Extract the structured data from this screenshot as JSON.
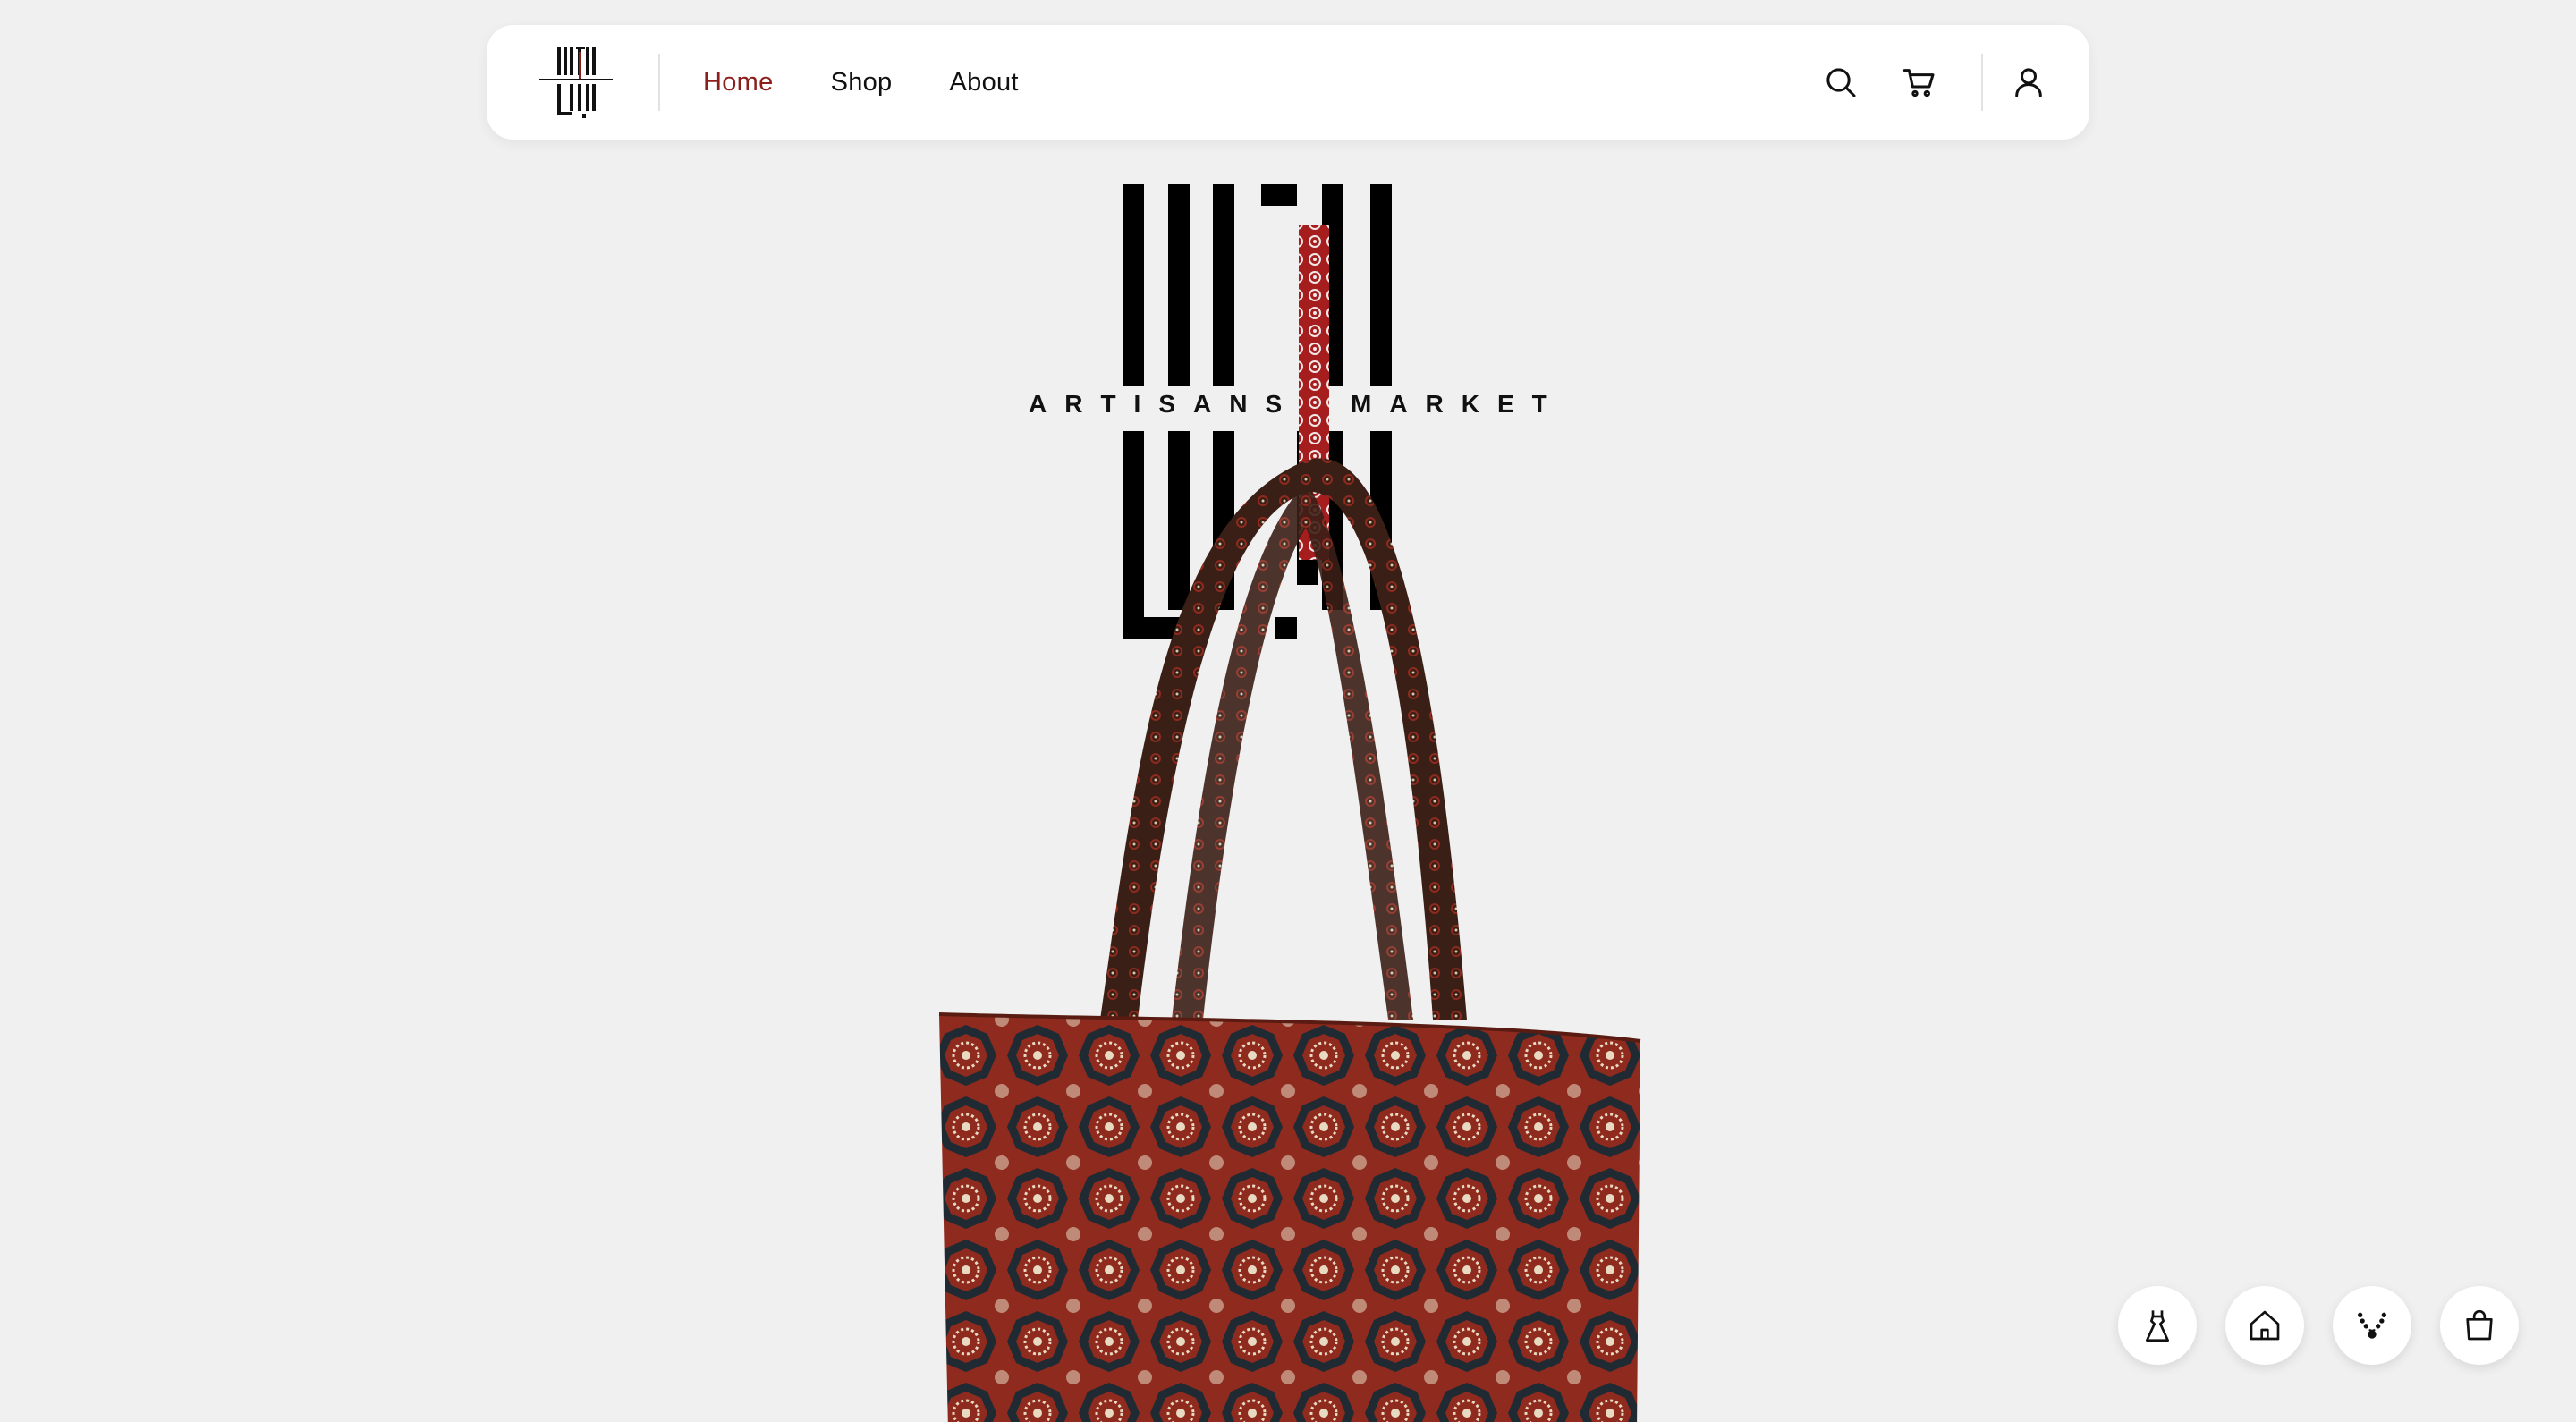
{
  "brand": {
    "name_ar": "انجاس",
    "tagline_left": "ARTISANS",
    "tagline_right": "MARKET"
  },
  "nav": {
    "links": [
      {
        "label": "Home",
        "active": true
      },
      {
        "label": "Shop",
        "active": false
      },
      {
        "label": "About",
        "active": false
      }
    ],
    "icons": [
      "search-icon",
      "cart-icon",
      "user-icon"
    ]
  },
  "hero": {
    "image": "patterned-tote-bag",
    "pattern_colors": {
      "red": "#8e2a1e",
      "navy": "#1f2a33",
      "cream": "#e8d9c1"
    }
  },
  "categories": [
    {
      "icon": "dress-icon"
    },
    {
      "icon": "home-icon"
    },
    {
      "icon": "necklace-icon"
    },
    {
      "icon": "bag-icon"
    }
  ],
  "colors": {
    "accent": "#8c1f1b",
    "background": "#f0f0f0",
    "nav_background": "#ffffff",
    "text": "#111111"
  }
}
